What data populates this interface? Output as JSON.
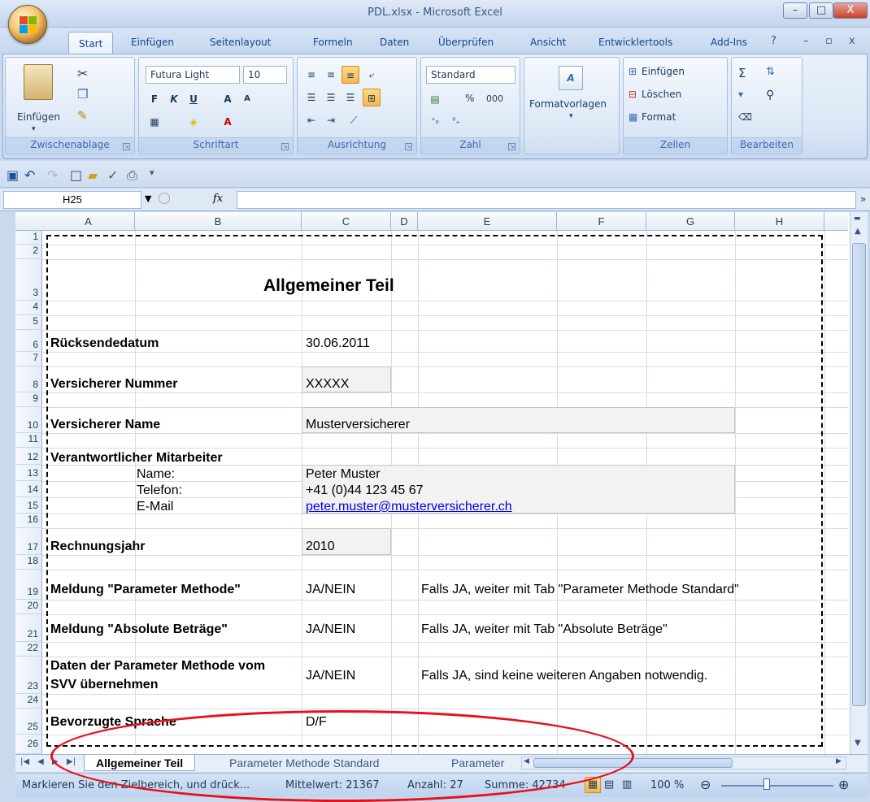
{
  "window": {
    "title": "PDL.xlsx - Microsoft Excel",
    "min": "–",
    "max": "□",
    "close": "X"
  },
  "ribbon_tabs": [
    "Start",
    "Einfügen",
    "Seitenlayout",
    "Formeln",
    "Daten",
    "Überprüfen",
    "Ansicht",
    "Entwicklertools",
    "Add-Ins"
  ],
  "ribbon": {
    "clipboard": {
      "label": "Zwischenablage",
      "paste": "Einfügen"
    },
    "font": {
      "label": "Schriftart",
      "name": "Futura Light",
      "size": "10"
    },
    "alignment": {
      "label": "Ausrichtung"
    },
    "number": {
      "label": "Zahl",
      "format": "Standard",
      "percent": "%",
      "thousands": "000"
    },
    "styles": {
      "label": "Formatvorlagen"
    },
    "cells": {
      "label": "Zellen",
      "insert": "Einfügen",
      "delete": "Löschen",
      "format": "Format"
    },
    "editing": {
      "label": "Bearbeiten"
    }
  },
  "formula_bar": {
    "cell_ref": "H25",
    "fx": "fx",
    "value": ""
  },
  "columns": [
    "A",
    "B",
    "C",
    "D",
    "E",
    "F",
    "G",
    "H"
  ],
  "rows": [
    "1",
    "2",
    "3",
    "4",
    "5",
    "6",
    "7",
    "8",
    "9",
    "10",
    "11",
    "12",
    "13",
    "14",
    "15",
    "16",
    "17",
    "18",
    "19",
    "20",
    "21",
    "22",
    "23",
    "24",
    "25",
    "26"
  ],
  "sheet": {
    "title": "Allgemeiner Teil",
    "ruecksendedatum_label": "Rücksendedatum",
    "ruecksendedatum_value": "30.06.2011",
    "vers_nummer_label": "Versicherer Nummer",
    "vers_nummer_value": "XXXXX",
    "vers_name_label": "Versicherer Name",
    "vers_name_value": "Musterversicherer",
    "mitarbeiter_label": "Verantwortlicher Mitarbeiter",
    "name_label": "Name:",
    "name_value": "Peter Muster",
    "telefon_label": "Telefon:",
    "telefon_value": "+41 (0)44 123 45 67",
    "email_label": "E-Mail",
    "email_value": "peter.muster@musterversicherer.ch",
    "rechnungsjahr_label": "Rechnungsjahr",
    "rechnungsjahr_value": "2010",
    "param_label": "Meldung \"Parameter Methode\"",
    "param_value": "JA/NEIN",
    "param_note": "Falls JA, weiter mit Tab \"Parameter Methode Standard\"",
    "abs_label": "Meldung \"Absolute Beträge\"",
    "abs_value": "JA/NEIN",
    "abs_note": "Falls JA, weiter mit Tab \"Absolute Beträge\"",
    "daten_label_1": "Daten der Parameter Methode vom",
    "daten_label_2": "SVV übernehmen",
    "daten_value": "JA/NEIN",
    "daten_note": "Falls JA, sind keine weiteren Angaben notwendig.",
    "sprache_label": "Bevorzugte Sprache",
    "sprache_value": "D/F"
  },
  "sheet_tabs": [
    "Allgemeiner Teil",
    "Parameter Methode Standard",
    "Parameter"
  ],
  "status": {
    "message": "Markieren Sie den Zielbereich, und drück...",
    "average": "Mittelwert: 21367",
    "count": "Anzahl: 27",
    "sum": "Summe: 42734",
    "zoom": "100 %"
  },
  "colors": {
    "ribbon": "#dbe7f6",
    "accent": "#15428b",
    "annotation": "#e8101a"
  }
}
